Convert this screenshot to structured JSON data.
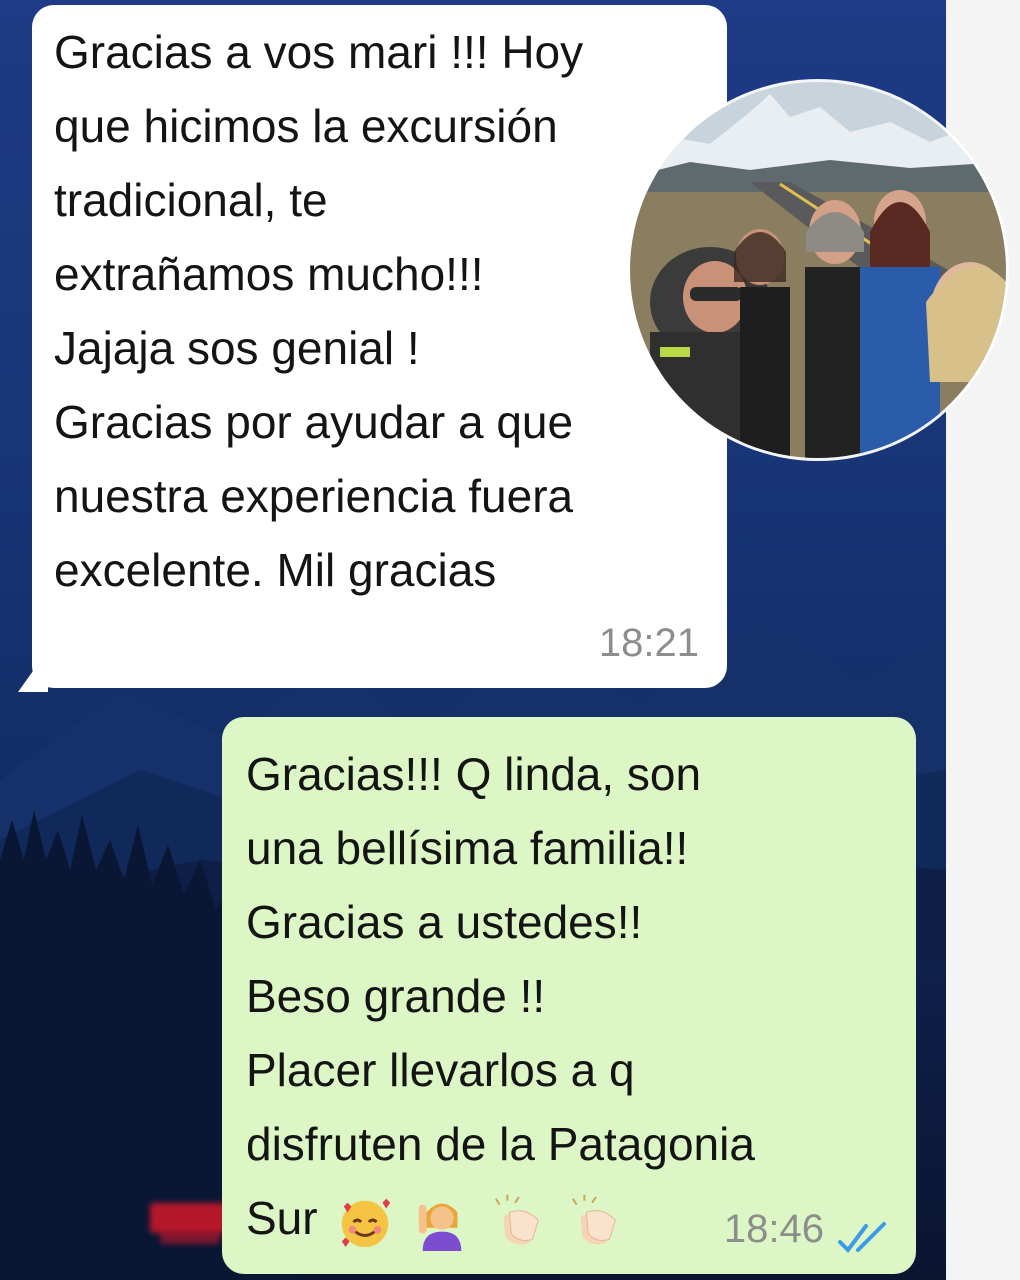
{
  "chat": {
    "incoming": {
      "lines": [
        "Gracias a vos mari !!! Hoy",
        "que hicimos la excursión",
        "tradicional, te",
        "extrañamos mucho!!!",
        "Jajaja sos genial !",
        "Gracias por ayudar a que",
        "nuestra experiencia fuera",
        "excelente. Mil gracias"
      ],
      "time": "18:21"
    },
    "outgoing": {
      "lines": [
        "Gracias!!! Q linda, son",
        "una bellísima familia!!",
        "Gracias a ustedes!!",
        "Beso grande !!",
        "Placer llevarlos a q",
        "disfruten de la Patagonia"
      ],
      "last_line_text": "Sur",
      "emojis": [
        "smiling-face-with-hearts-icon",
        "person-raising-hand-icon",
        "clapping-hands-icon",
        "clapping-hands-icon"
      ],
      "time": "18:46",
      "status": "read-double-check-icon"
    }
  },
  "colors": {
    "incoming_bubble": "#ffffff",
    "outgoing_bubble": "#dcf7c5",
    "read_ticks": "#3c9be8",
    "timestamp": "#8d8d8d"
  }
}
